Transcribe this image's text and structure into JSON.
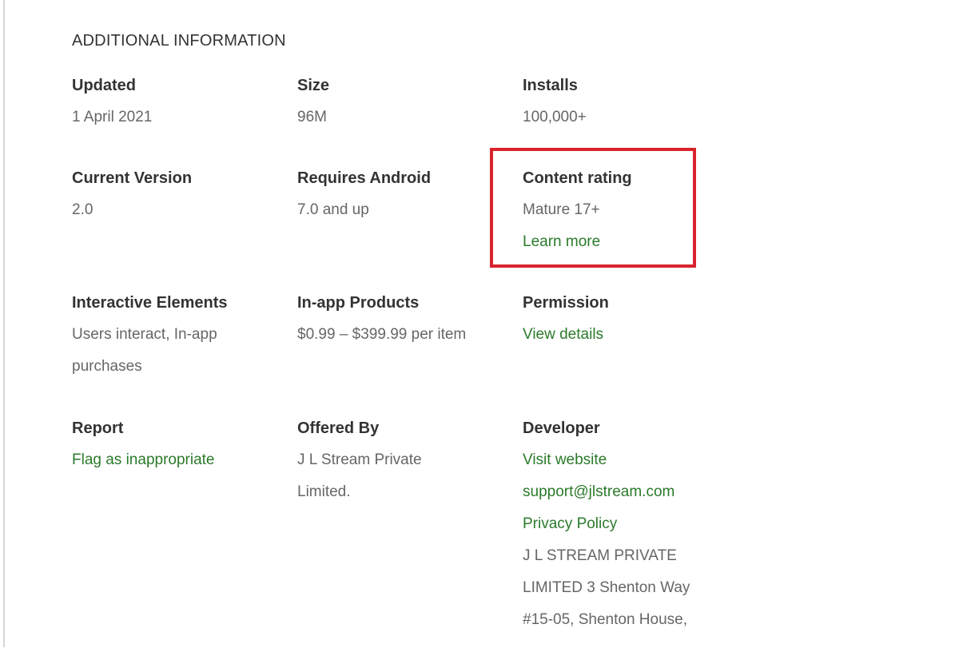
{
  "section": {
    "title": "ADDITIONAL INFORMATION"
  },
  "info": {
    "updated": {
      "label": "Updated",
      "value": "1 April 2021"
    },
    "size": {
      "label": "Size",
      "value": "96M"
    },
    "installs": {
      "label": "Installs",
      "value": "100,000+"
    },
    "current_version": {
      "label": "Current Version",
      "value": "2.0"
    },
    "requires_android": {
      "label": "Requires Android",
      "value": "7.0 and up"
    },
    "content_rating": {
      "label": "Content rating",
      "value": "Mature 17+",
      "link": "Learn more"
    },
    "interactive_elements": {
      "label": "Interactive Elements",
      "line1": "Users interact, In-app",
      "line2": "purchases"
    },
    "in_app_products": {
      "label": "In-app Products",
      "value": "$0.99 – $399.99 per item"
    },
    "permission": {
      "label": "Permission",
      "link": "View details"
    },
    "report": {
      "label": "Report",
      "link": "Flag as inappropriate"
    },
    "offered_by": {
      "label": "Offered By",
      "line1": "J L Stream Private",
      "line2": "Limited."
    },
    "developer": {
      "label": "Developer",
      "website": "Visit website",
      "email": "support@jlstream.com",
      "privacy": "Privacy Policy",
      "address_line1": "J L STREAM PRIVATE",
      "address_line2": "LIMITED 3 Shenton Way",
      "address_line3": "#15-05, Shenton House,"
    }
  },
  "colors": {
    "link": "#2b7a2b",
    "highlight": "#d9232d",
    "label": "#333333",
    "value": "#666666"
  }
}
